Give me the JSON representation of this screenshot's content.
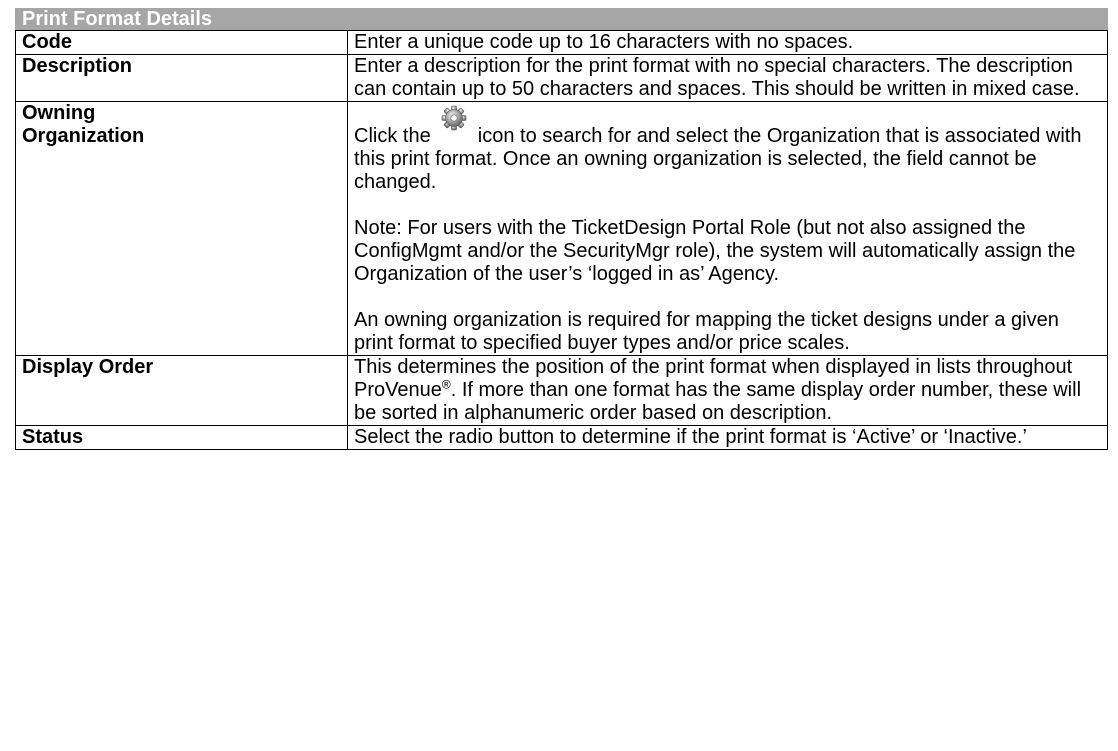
{
  "header": {
    "title": "Print Format Details"
  },
  "rows": [
    {
      "label": "Code",
      "paragraphs": [
        "Enter a unique code up to 16 characters with no spaces."
      ]
    },
    {
      "label": "Description",
      "paragraphs": [
        "Enter a description for the print format with no special characters. The description can contain up to 50 characters and spaces. This should be written in mixed case."
      ]
    },
    {
      "label": "Owning Organization",
      "intro_before_icon": "Click the",
      "icon": "gear-icon",
      "intro_after_icon": "icon to search for and select the Organization that is associated with this print format. Once an owning organization is selected, the field cannot be changed.",
      "note": "Note: For users with the TicketDesign Portal Role (but not also assigned the ConfigMgmt and/or the SecurityMgr role), the system will automatically assign the Organization of the user’s ‘logged in as’ Agency.",
      "requirement": "An owning organization is required for mapping the ticket designs under a given print format to specified buyer types and/or price scales."
    },
    {
      "label": "Display Order",
      "text_before_sup": "This determines the position of the print format when displayed in lists throughout ProVenue",
      "sup": "®",
      "text_after_sup": ". If more than one format has the same display order number, these will be sorted in alphanumeric order based on description."
    },
    {
      "label": "Status",
      "paragraphs": [
        "Select the radio button to determine if the print format is ‘Active’ or ‘Inactive.’"
      ]
    }
  ],
  "colors": {
    "header_bg": "#a6a6a6",
    "header_text": "#ffffff",
    "border": "#000000"
  }
}
